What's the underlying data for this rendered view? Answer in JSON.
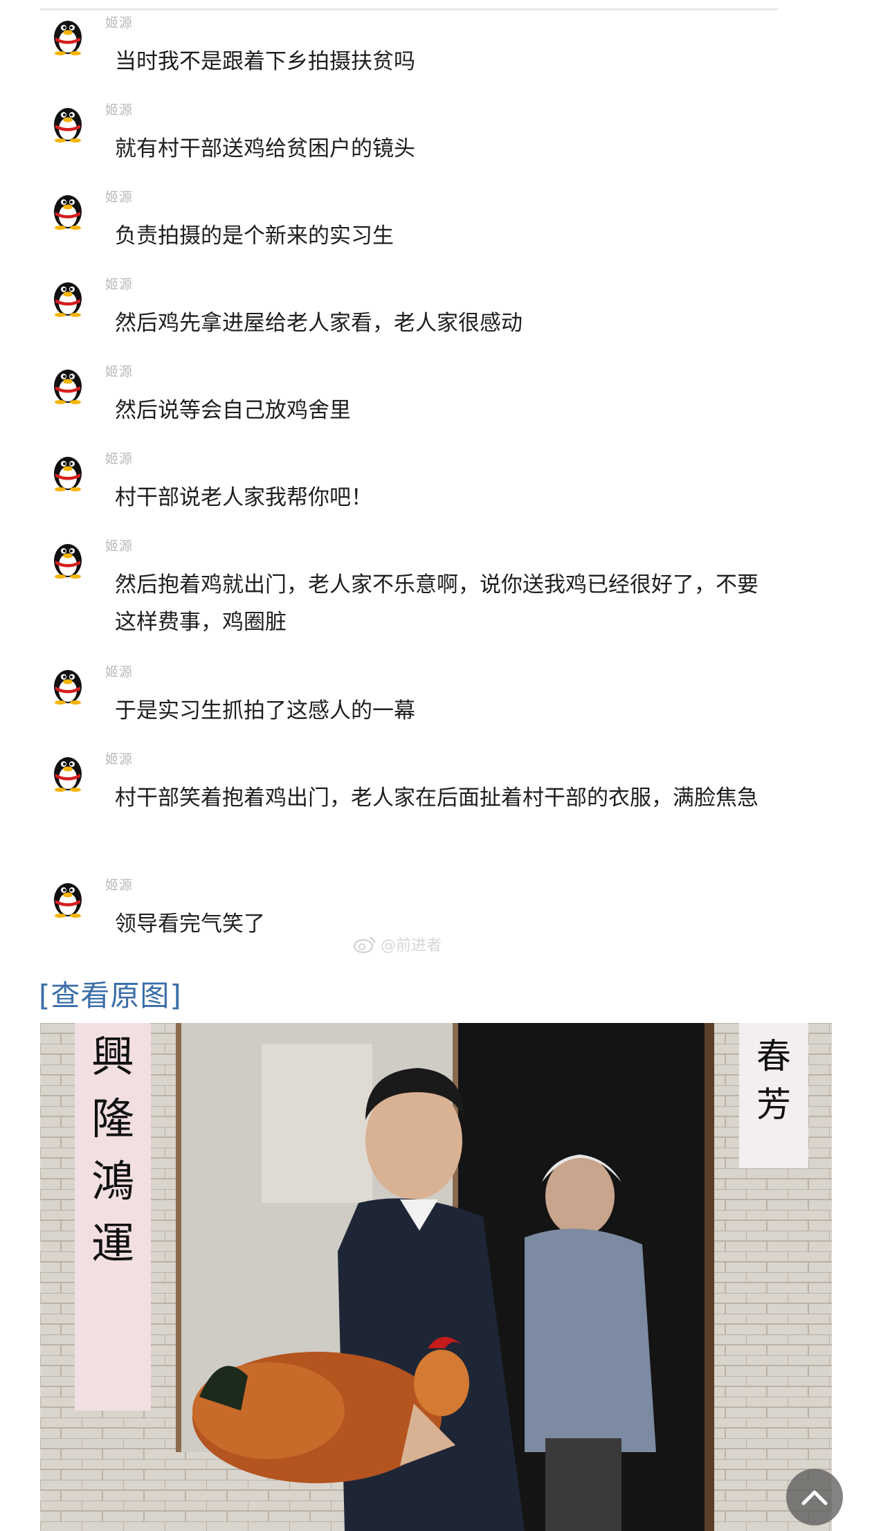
{
  "messages": [
    {
      "sender": "姬源",
      "text": "当时我不是跟着下乡拍摄扶贫吗"
    },
    {
      "sender": "姬源",
      "text": "就有村干部送鸡给贫困户的镜头"
    },
    {
      "sender": "姬源",
      "text": "负责拍摄的是个新来的实习生"
    },
    {
      "sender": "姬源",
      "text": "然后鸡先拿进屋给老人家看，老人家很感动"
    },
    {
      "sender": "姬源",
      "text": "然后说等会自己放鸡舍里"
    },
    {
      "sender": "姬源",
      "text": "村干部说老人家我帮你吧！"
    },
    {
      "sender": "姬源",
      "text": "然后抱着鸡就出门，老人家不乐意啊，说你送我鸡已经很好了，不要这样费事，鸡圈脏"
    },
    {
      "sender": "姬源",
      "text": "于是实习生抓拍了这感人的一幕"
    },
    {
      "sender": "姬源",
      "text": "村干部笑着抱着鸡出门，老人家在后面扯着村干部的衣服，满脸焦急"
    },
    {
      "sender": "姬源",
      "text": "领导看完气笑了"
    }
  ],
  "watermark": "@前进者",
  "view_original_label": "[查看原图]",
  "photo": {
    "couplet_left": "興隆鴻運",
    "couplet_right": "春芳"
  },
  "icons": {
    "avatar": "qq-penguin-icon",
    "scroll_top": "chevron-up-icon"
  }
}
